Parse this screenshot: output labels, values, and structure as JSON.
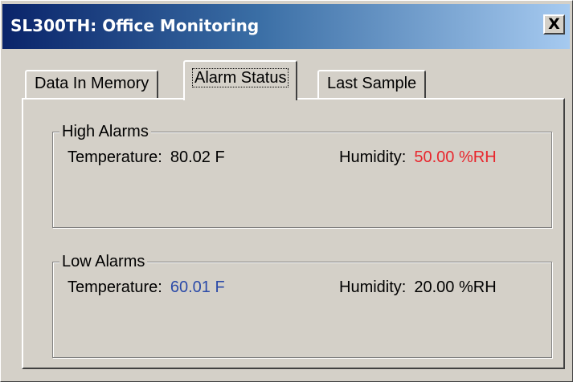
{
  "window": {
    "title": "SL300TH: Office Monitoring",
    "close_label": "X"
  },
  "tabs": [
    {
      "label": "Data In Memory"
    },
    {
      "label": "Alarm Status",
      "active": true
    },
    {
      "label": "Last Sample"
    }
  ],
  "high_alarms": {
    "title": "High Alarms",
    "temperature_label": "Temperature:",
    "temperature_value": "80.02 F",
    "humidity_label": "Humidity:",
    "humidity_value": "50.00 %RH"
  },
  "low_alarms": {
    "title": "Low Alarms",
    "temperature_label": "Temperature:",
    "temperature_value": "60.01 F",
    "humidity_label": "Humidity:",
    "humidity_value": "20.00 %RH"
  },
  "colors": {
    "title_gradient_start": "#0a246a",
    "title_gradient_end": "#a6caf0",
    "alarm_red": "#e8262d",
    "alarm_blue": "#2b4aa8",
    "window_bg": "#d4d0c8"
  }
}
